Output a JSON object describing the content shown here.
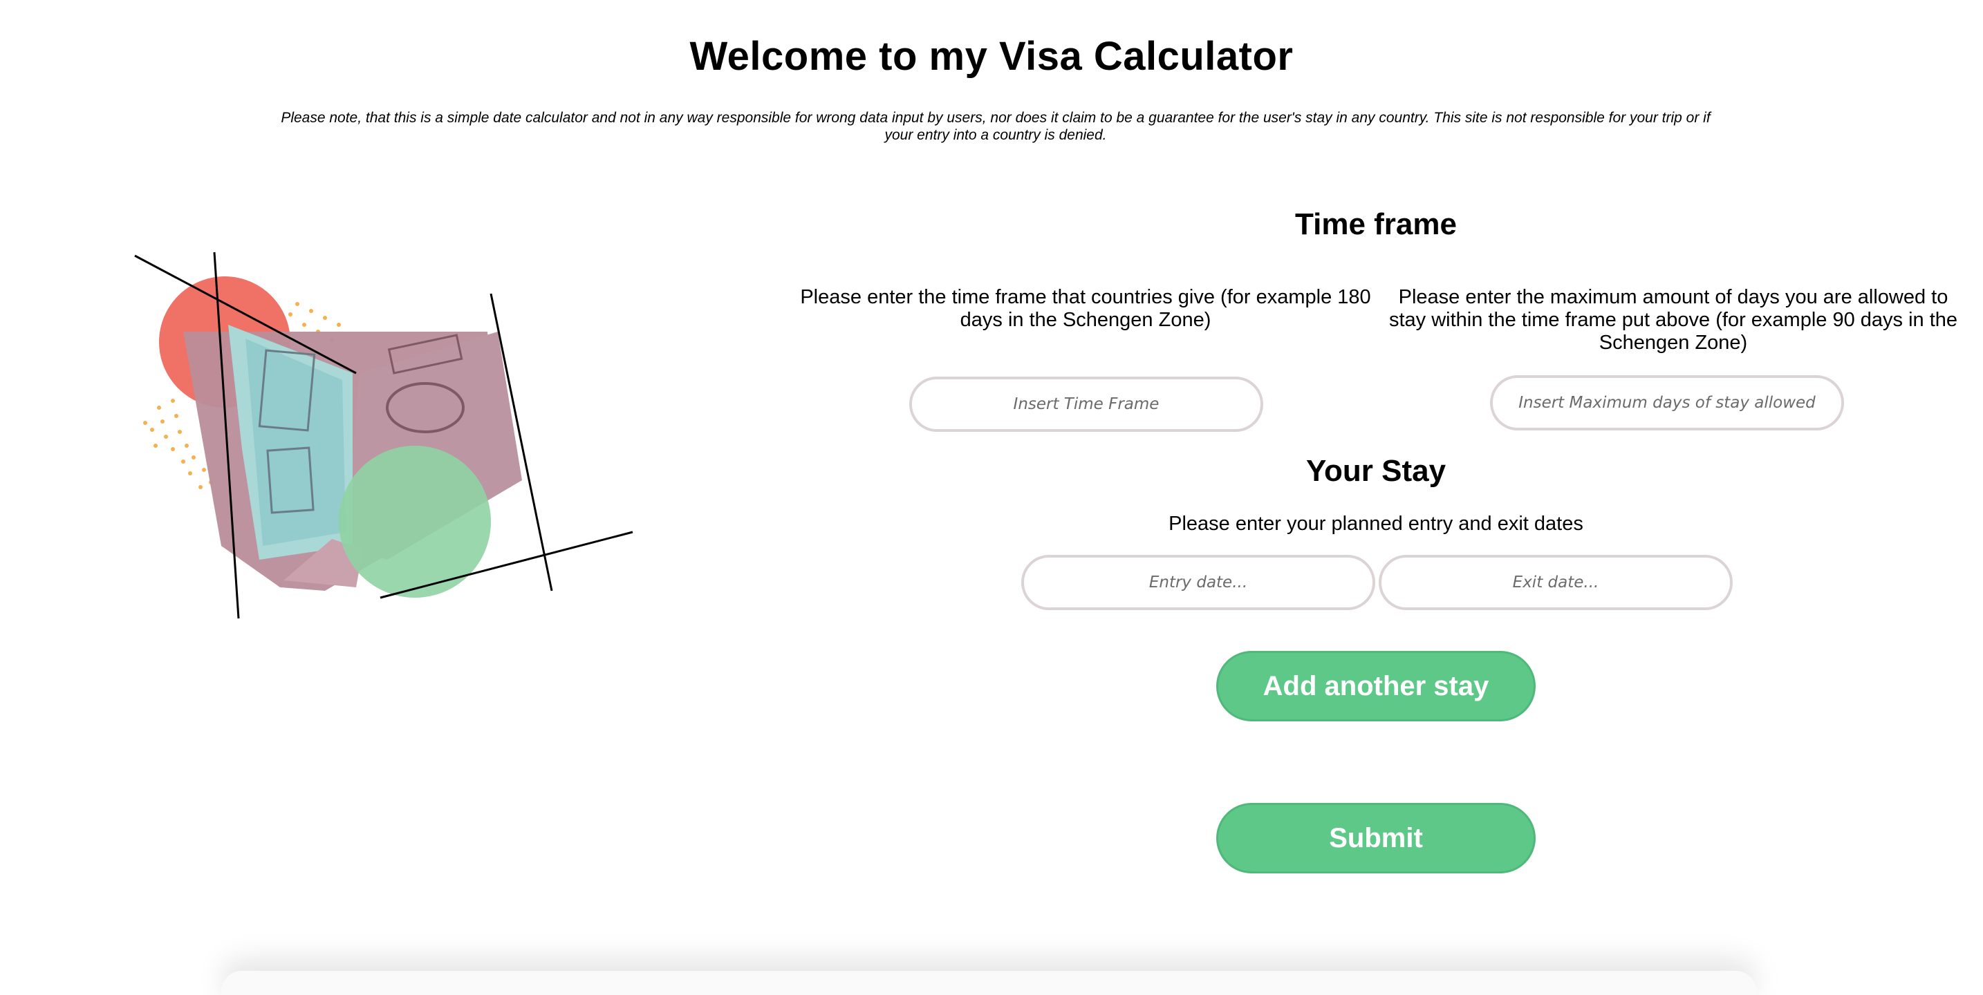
{
  "header": {
    "title": "Welcome to my Visa Calculator",
    "disclaimer": "Please note, that this is a simple date calculator and not in any way responsible for wrong data input by users, nor does it claim to be a guarantee for the user's stay in any country. This site is not responsible for your trip or if your entry into a country is denied."
  },
  "illustration": {
    "icon": "passport-collage-image",
    "colors": {
      "red_circle": "#f07166",
      "green_circle": "#8fd3a3",
      "dots": "#f5b14f",
      "passport": "#b98d9a",
      "pages": "#a9d8d6"
    }
  },
  "time_frame": {
    "title": "Time frame",
    "frame_description": "Please enter the time frame that countries give (for example 180 days in the Schengen Zone)",
    "max_description": "Please enter the maximum amount of days you are allowed to stay within the time frame put above (for example 90 days in the Schengen Zone)",
    "frame_placeholder": "Insert Time Frame",
    "max_placeholder": "Insert Maximum days of stay allowed"
  },
  "stay": {
    "title": "Your Stay",
    "description": "Please enter your planned entry and exit dates",
    "entry_placeholder": "Entry date...",
    "exit_placeholder": "Exit date..."
  },
  "buttons": {
    "add_stay": "Add another stay",
    "submit": "Submit",
    "color": "#5dc888"
  }
}
